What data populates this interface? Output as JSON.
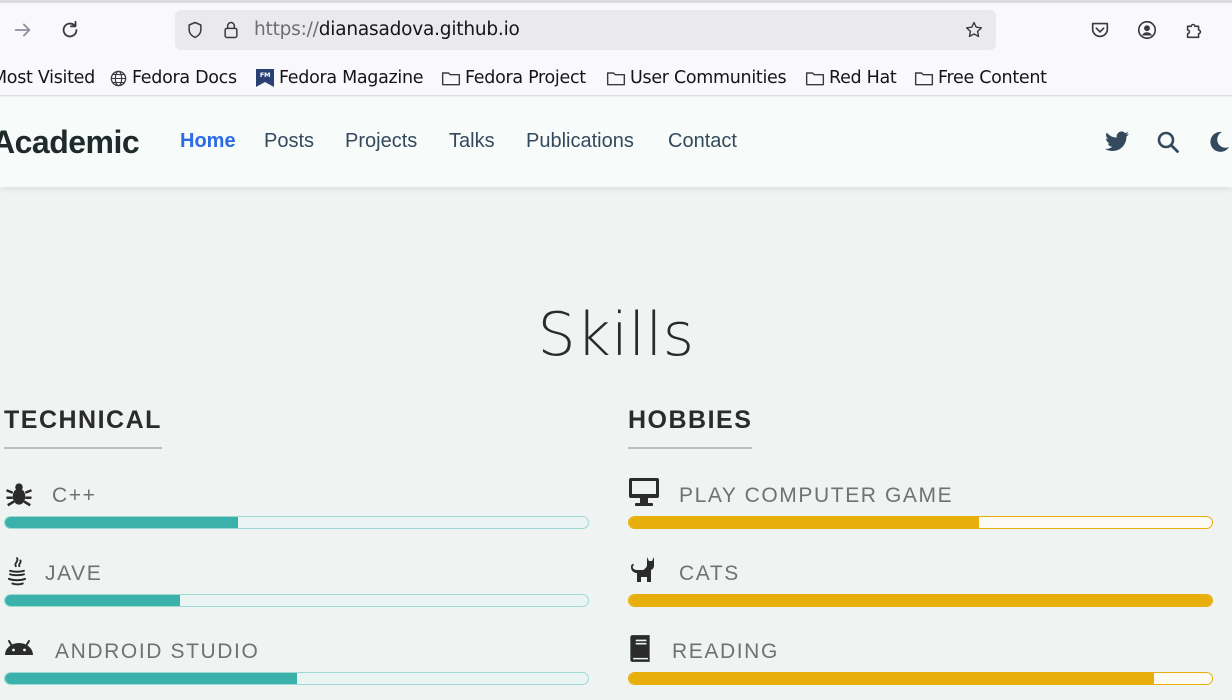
{
  "browser": {
    "url_scheme": "https://",
    "url_host": "dianasadova.github.io",
    "bookmarks": [
      {
        "label": "Most Visited",
        "icon": "none"
      },
      {
        "label": "Fedora Docs",
        "icon": "globe-icon"
      },
      {
        "label": "Fedora Magazine",
        "icon": "fm-icon"
      },
      {
        "label": "Fedora Project",
        "icon": "folder-icon"
      },
      {
        "label": "User Communities",
        "icon": "folder-icon"
      },
      {
        "label": "Red Hat",
        "icon": "folder-icon"
      },
      {
        "label": "Free Content",
        "icon": "folder-icon"
      }
    ]
  },
  "site": {
    "brand": "Academic",
    "nav": [
      "Home",
      "Posts",
      "Projects",
      "Talks",
      "Publications",
      "Contact"
    ],
    "active_nav": "Home"
  },
  "skills": {
    "title": "Skills",
    "technical": {
      "heading": "TECHNICAL",
      "items": [
        {
          "label": "C++",
          "icon": "bug-icon",
          "level": 40
        },
        {
          "label": "JAVE",
          "icon": "java-icon",
          "level": 30
        },
        {
          "label": "ANDROID STUDIO",
          "icon": "android-icon",
          "level": 50
        }
      ]
    },
    "hobbies": {
      "heading": "HOBBIES",
      "items": [
        {
          "label": "PLAY COMPUTER GAME",
          "icon": "desktop-icon",
          "level": 60
        },
        {
          "label": "CATS",
          "icon": "cat-icon",
          "level": 100
        },
        {
          "label": "READING",
          "icon": "book-icon",
          "level": 90
        }
      ]
    }
  },
  "colors": {
    "accent_nav": "#2b6be6",
    "technical_bar": "#3ab1aa",
    "hobby_bar": "#e8ae0c"
  }
}
